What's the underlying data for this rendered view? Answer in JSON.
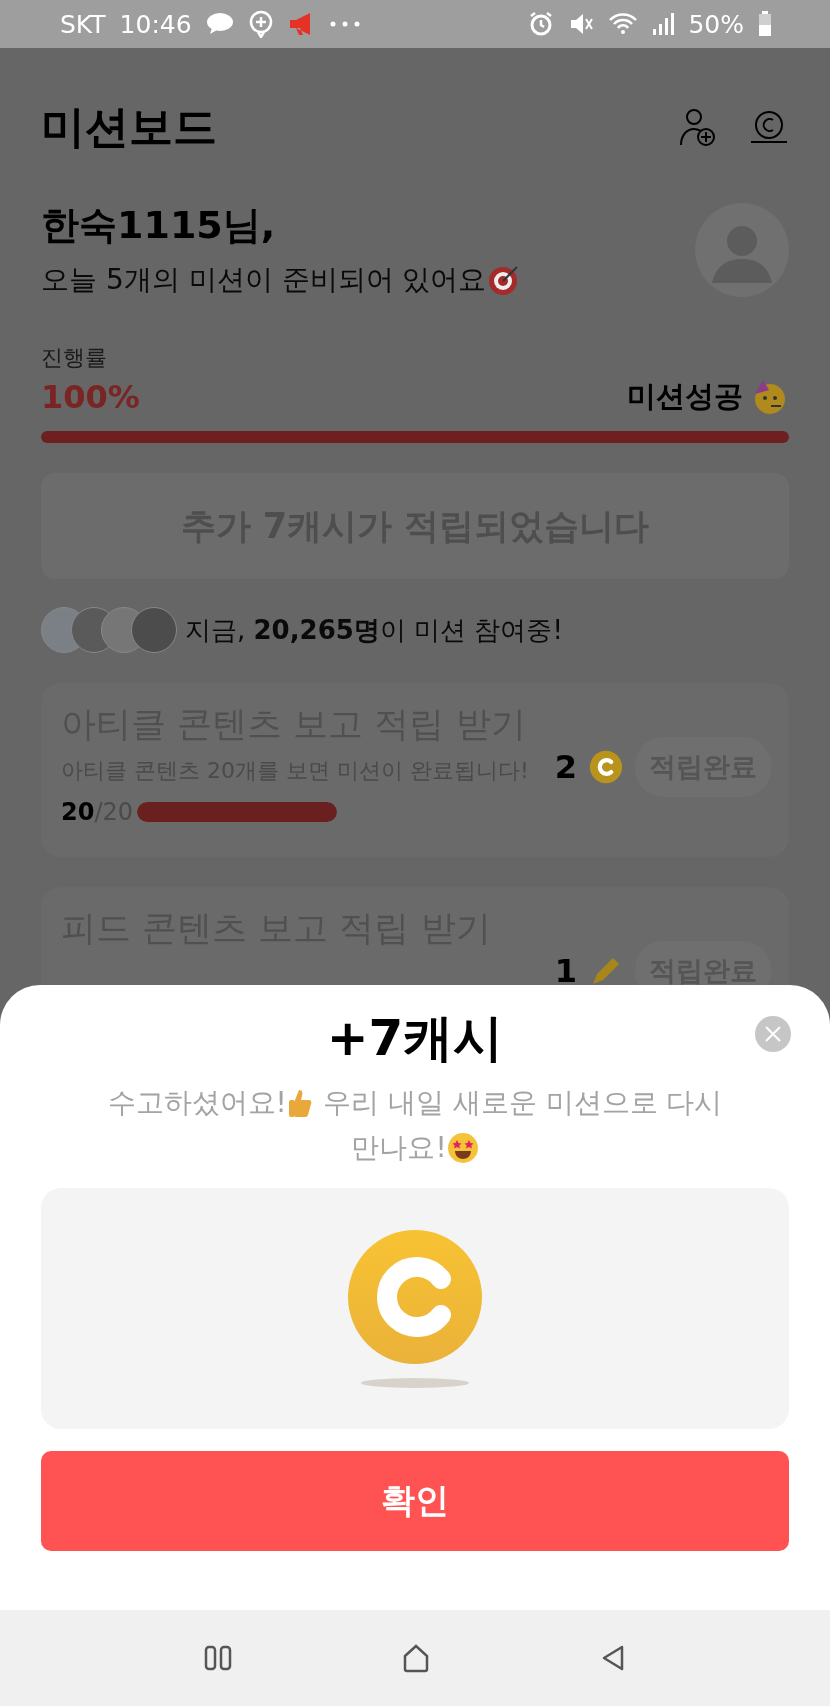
{
  "status_bar": {
    "carrier": "SKT",
    "time": "10:46",
    "battery": "50%"
  },
  "header": {
    "title": "미션보드"
  },
  "greeting": {
    "name": "한숙1115님,",
    "message": "오늘 5개의 미션이 준비되어 있어요"
  },
  "progress": {
    "label": "진행률",
    "value": "100%",
    "level": 1,
    "result": "미션성공"
  },
  "banner": "추가 7캐시가 적립되었습니다",
  "participants": "지금, **20,265명**이 미션 참여중!",
  "missions": [
    {
      "title": "아티클 콘텐츠 보고 적립 받기",
      "description": "아티클 콘텐츠 20개를 보면 미션이 완료됩니다!",
      "count": "**20**/20",
      "level": 1,
      "reward": "2",
      "button": "적립완료"
    },
    {
      "title": "피드 콘텐츠 보고 적립 받기",
      "reward": "1",
      "button": "적립완료"
    }
  ],
  "sheet": {
    "title": "+7캐시",
    "message_1": "수고하셨어요!",
    "message_2": "우리 내일 새로운 미션으로 다시",
    "message_3": "만나요!",
    "confirm": "확인"
  }
}
